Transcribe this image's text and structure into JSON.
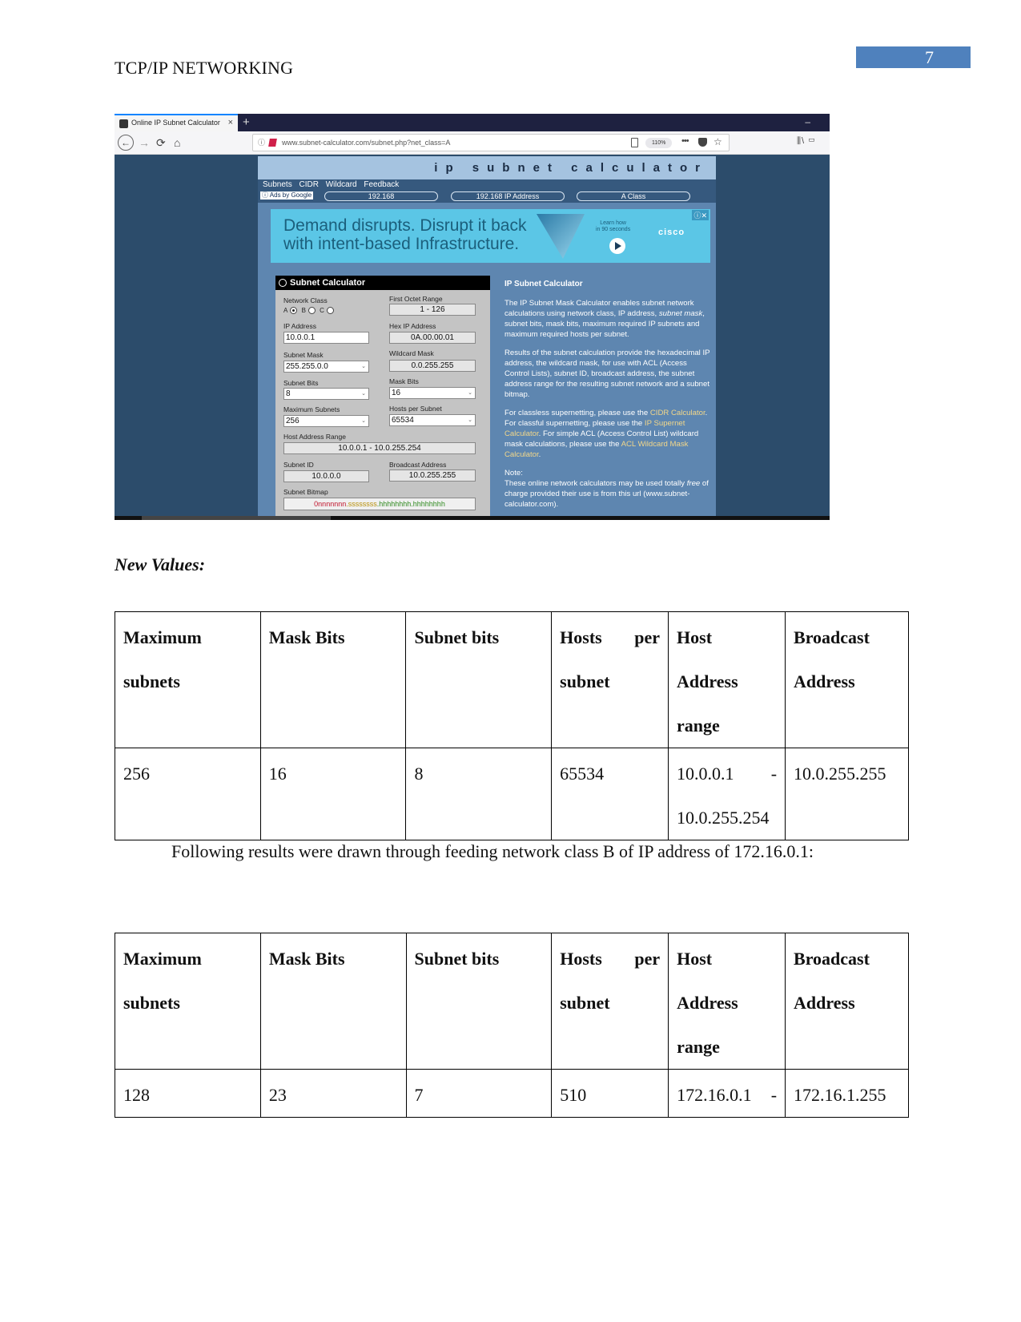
{
  "header": {
    "running_head": "TCP/IP NETWORKING",
    "page_number": "7",
    "page_number_color": "#4f81bd"
  },
  "screenshot": {
    "browser": {
      "tab_title": "Online IP Subnet Calculator",
      "tab_close": "×",
      "new_tab": "+",
      "minimize": "–",
      "nav_back": "←",
      "nav_forward": "→",
      "reload": "⟳",
      "home": "⌂",
      "info_icon": "ⓘ",
      "url": "www.subnet-calculator.com/subnet.php?net_class=A",
      "zoom_level": "110%",
      "more": "•••",
      "star": "☆",
      "toolbar_right": "⫼\\ ▭"
    },
    "site": {
      "banner": "ip subnet calculator",
      "nav_links": "Subnets CIDR Wildcard Feedback",
      "ads_label": "ⓘ Ads by Google",
      "ad_pills": [
        "192.168",
        "192.168 IP Address",
        "A Class"
      ],
      "ad": {
        "headline_line1": "Demand disrupts. Disrupt it back",
        "headline_line2": "with intent-based Infrastructure.",
        "cta_line1": "Learn how",
        "cta_line2": "in 90 seconds",
        "brand": "cisco",
        "close": "ⓘ✕",
        "bg_color": "#5bc6e6"
      },
      "calculator": {
        "title": "Subnet Calculator",
        "network_class_label": "Network Class",
        "class_options": [
          "A",
          "B",
          "C"
        ],
        "class_selected": "A",
        "first_octet_range_label": "First Octet Range",
        "first_octet_range": "1 - 126",
        "ip_address_label": "IP Address",
        "ip_address": "10.0.0.1",
        "hex_ip_label": "Hex IP Address",
        "hex_ip": "0A.00.00.01",
        "subnet_mask_label": "Subnet Mask",
        "subnet_mask": "255.255.0.0",
        "wildcard_mask_label": "Wildcard Mask",
        "wildcard_mask": "0.0.255.255",
        "subnet_bits_label": "Subnet Bits",
        "subnet_bits": "8",
        "mask_bits_label": "Mask Bits",
        "mask_bits": "16",
        "max_subnets_label": "Maximum Subnets",
        "max_subnets": "256",
        "hosts_per_subnet_label": "Hosts per Subnet",
        "hosts_per_subnet": "65534",
        "host_range_label": "Host Address Range",
        "host_range": "10.0.0.1 - 10.0.255.254",
        "subnet_id_label": "Subnet ID",
        "subnet_id": "10.0.0.0",
        "broadcast_label": "Broadcast Address",
        "broadcast": "10.0.255.255",
        "bitmap_label": "Subnet Bitmap",
        "bitmap_network": "0nnnnnnn",
        "bitmap_subnet": ".ssssssss",
        "bitmap_hosts": ".hhhhhhhh.hhhhhhhh",
        "dropdown_glyph": "⌄"
      },
      "info": {
        "title": "IP Subnet Calculator",
        "p1_a": "The IP Subnet Mask Calculator enables subnet network calculations using network class, IP address, ",
        "p1_em": "subnet mask",
        "p1_b": ", subnet bits, mask bits, maximum required IP subnets and maximum required hosts per subnet.",
        "p2": "Results of the subnet calculation provide the hexadecimal IP address, the wildcard mask, for use with ACL (Access Control Lists), subnet ID, broadcast address, the subnet address range for the resulting subnet network and a subnet bitmap.",
        "p3_a": "For classless supernetting, please use the ",
        "p3_link1": "CIDR Calculator",
        "p3_b": ". For classful supernetting, please use the ",
        "p3_link2": "IP Supernet Calculator",
        "p3_c": ". For simple ACL (Access Control List) wildcard mask calculations, please use the ",
        "p3_link3": "ACL Wildcard Mask Calculator",
        "p3_d": ".",
        "note_label": "Note:",
        "note_a": "These online network calculators may be used totally ",
        "note_em": "free",
        "note_b": " of charge provided their use is from this url (www.subnet-calculator.com)."
      }
    }
  },
  "section_heading": "New Values:",
  "table_headers": [
    [
      "Maximum",
      "subnets"
    ],
    [
      "Mask Bits"
    ],
    [
      "Subnet bits"
    ],
    [
      "Hosts per",
      "subnet"
    ],
    [
      "Host",
      "Address",
      "range"
    ],
    [
      "Broadcast",
      "Address"
    ]
  ],
  "table1": {
    "row": {
      "max_subnets": "256",
      "mask_bits": "16",
      "subnet_bits": "8",
      "hosts_per_subnet": "65534",
      "host_range_start": "10.0.0.1",
      "host_range_dash": "-",
      "host_range_end": "10.0.255.254",
      "broadcast": "10.0.255.255"
    }
  },
  "paragraph": "Following results were drawn through feeding network class B of IP address of 172.16.0.1:",
  "table2": {
    "row": {
      "max_subnets": "128",
      "mask_bits": "23",
      "subnet_bits": "7",
      "hosts_per_subnet": "510",
      "host_range_start": "172.16.0.1",
      "host_range_dash": "-",
      "broadcast": "172.16.1.255"
    }
  }
}
